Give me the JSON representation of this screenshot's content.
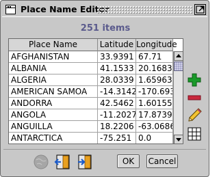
{
  "window": {
    "title": "Place Name Editor",
    "maximize_icon": "maximize-icon"
  },
  "summary": {
    "items_count": "251 items"
  },
  "table": {
    "columns": [
      "Place Name",
      "Latitude",
      "Longitude"
    ],
    "rows": [
      {
        "name": "AFGHANISTAN",
        "lat": "33.9391",
        "lon": "67.71"
      },
      {
        "name": "ALBANIA",
        "lat": "41.1533",
        "lon": "20.1683"
      },
      {
        "name": "ALGERIA",
        "lat": "28.0339",
        "lon": "1.65963"
      },
      {
        "name": "AMERICAN SAMOA",
        "lat": "-14.3142",
        "lon": "-170.693"
      },
      {
        "name": "ANDORRA",
        "lat": "42.5462",
        "lon": "1.60155"
      },
      {
        "name": "ANGOLA",
        "lat": "-11.2027",
        "lon": "17.8739"
      },
      {
        "name": "ANGUILLA",
        "lat": "18.2206",
        "lon": "-63.0686"
      },
      {
        "name": "ANTARCTICA",
        "lat": "-75.251",
        "lon": "0.0"
      }
    ]
  },
  "side_toolbar": {
    "add_icon": "plus-icon",
    "remove_icon": "minus-icon",
    "edit_icon": "pencil-icon",
    "grid_icon": "grid-icon"
  },
  "bottom_bar": {
    "globe_icon": "globe-icon",
    "import_icon": "import-icon",
    "export_icon": "export-icon",
    "ok_label": "OK",
    "cancel_label": "Cancel"
  },
  "colors": {
    "items_count": "#5a5a8c",
    "add": "#1a9a2a",
    "remove": "#c8283c",
    "scroll_thumb": "#a8a8cc"
  }
}
